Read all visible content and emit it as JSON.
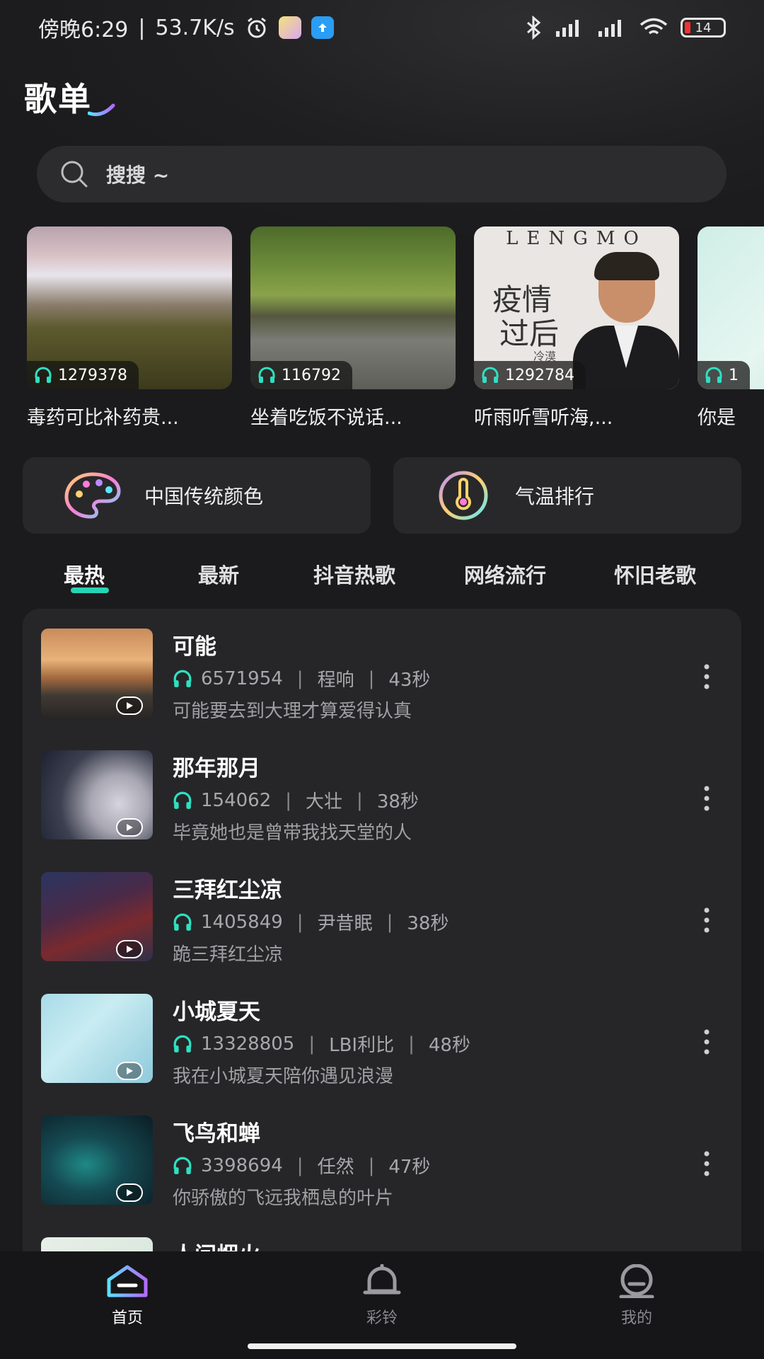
{
  "status_bar": {
    "time": "傍晚6:29",
    "speed": "53.7K/s",
    "battery": "14"
  },
  "page_title": "歌单",
  "search": {
    "placeholder": "搜搜 ~"
  },
  "playlists": [
    {
      "count": "1279378",
      "title": "毒药可比补药贵..."
    },
    {
      "count": "116792",
      "title": "坐着吃饭不说话..."
    },
    {
      "count": "1292784",
      "title": "听雨听雪听海,..."
    },
    {
      "count": "1",
      "title": "你是"
    }
  ],
  "playlist_3_cover_text": {
    "brand": "LENGMO",
    "line1": "疫情",
    "line2": "过后",
    "artist": "冷漠"
  },
  "features": [
    {
      "label": "中国传统颜色",
      "icon": "palette-icon"
    },
    {
      "label": "气温排行",
      "icon": "thermometer-icon"
    }
  ],
  "tabs": [
    "最热",
    "最新",
    "抖音热歌",
    "网络流行",
    "怀旧老歌"
  ],
  "active_tab": "最热",
  "songs": [
    {
      "name": "可能",
      "plays": "6571954",
      "artist": "程响",
      "duration": "43秒",
      "lyric": "可能要去到大理才算爱得认真"
    },
    {
      "name": "那年那月",
      "plays": "154062",
      "artist": "大壮",
      "duration": "38秒",
      "lyric": "毕竟她也是曾带我找天堂的人"
    },
    {
      "name": "三拜红尘凉",
      "plays": "1405849",
      "artist": "尹昔眠",
      "duration": "38秒",
      "lyric": "跪三拜红尘凉"
    },
    {
      "name": "小城夏天",
      "plays": "13328805",
      "artist": "LBI利比",
      "duration": "48秒",
      "lyric": "我在小城夏天陪你遇见浪漫"
    },
    {
      "name": "飞鸟和蝉",
      "plays": "3398694",
      "artist": "任然",
      "duration": "47秒",
      "lyric": "你骄傲的飞远我栖息的叶片"
    },
    {
      "name": "人间烟火",
      "plays": "",
      "artist": "",
      "duration": "",
      "lyric": ""
    }
  ],
  "bottom_nav": [
    {
      "label": "首页",
      "icon": "home-icon",
      "active": true
    },
    {
      "label": "彩铃",
      "icon": "bell-icon",
      "active": false
    },
    {
      "label": "我的",
      "icon": "profile-icon",
      "active": false
    }
  ],
  "colors": {
    "accent": "#26d4b4",
    "background": "#1b1b1d",
    "panel": "#262628"
  }
}
